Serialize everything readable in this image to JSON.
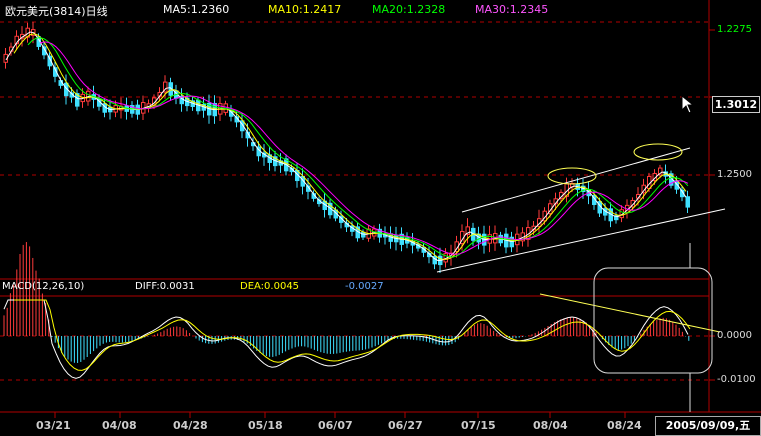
{
  "header": {
    "symbol": "欧元美元(3814)日线",
    "ma5": "MA5:1.2360",
    "ma10": "MA10:1.2417",
    "ma20": "MA20:1.2328",
    "ma30": "MA30:1.2345"
  },
  "macd_header": {
    "title": "MACD(12,26,10)",
    "diff": "DIFF:0.0031",
    "dea": "DEA:0.0045",
    "macd": "-0.0027"
  },
  "price_axis": {
    "top_label": "1.2275",
    "current_price": "1.3012",
    "mid_label": "1.2500"
  },
  "macd_axis": {
    "zero_label": "0.0000",
    "low_label": "-0.0100"
  },
  "x_labels": [
    "03/21",
    "04/08",
    "04/28",
    "05/18",
    "06/07",
    "06/27",
    "07/15",
    "08/04",
    "08/24"
  ],
  "current_date": "2005/09/09,五",
  "colors": {
    "up_candle": "#ff3b3b",
    "down_candle": "#3fe0ff",
    "ma5": "#ffffff",
    "ma10": "#ffff00",
    "ma20": "#00ff00",
    "ma30": "#ff00ff",
    "grid": "#b00000",
    "header_text": "#ffffff",
    "ma20_text": "#00ff00",
    "ma30_text": "#ff55ff",
    "macd_val_text": "#66aaff"
  },
  "icons": [
    "mouse-cursor-icon"
  ]
}
